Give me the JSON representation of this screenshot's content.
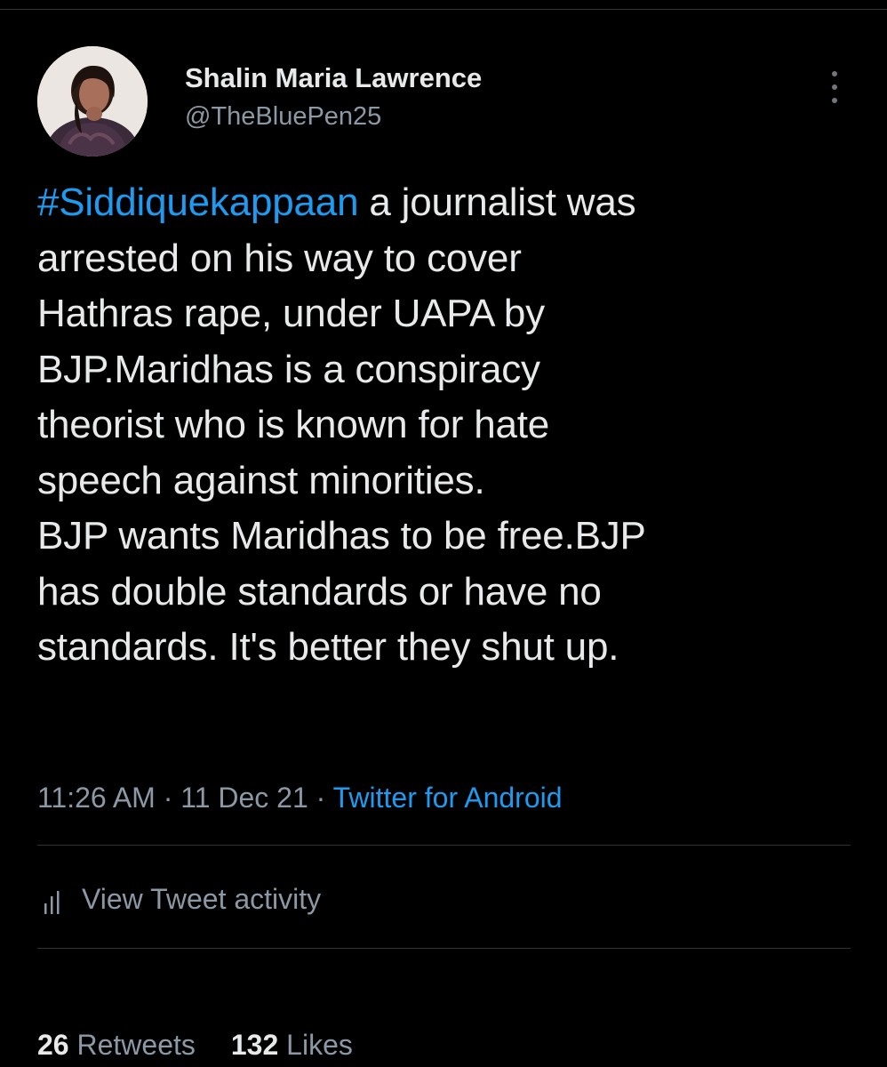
{
  "tweet": {
    "author": {
      "display_name": "Shalin Maria Lawrence",
      "username": "@TheBluePen25"
    },
    "hashtag": "#Siddiquekappaan",
    "body": " a journalist was\narrested on his way to cover\nHathras rape, under UAPA by\nBJP.Maridhas is a conspiracy\ntheorist who is known for hate\nspeech against minorities.\nBJP wants Maridhas to be free.BJP\nhas double standards or have no\nstandards. It's better they shut up.",
    "time": "11:26 AM",
    "separator": " · ",
    "date": "11 Dec 21",
    "source": "Twitter for Android"
  },
  "activity": {
    "label": "View Tweet activity",
    "icon": "bar-chart-icon"
  },
  "stats": {
    "retweets_count": "26",
    "retweets_label": "Retweets",
    "likes_count": "132",
    "likes_label": "Likes"
  },
  "colors": {
    "background": "#000000",
    "text_primary": "#e7e9ea",
    "text_secondary": "#8b98a5",
    "accent": "#1d9bf0",
    "divider": "#2f3336"
  }
}
